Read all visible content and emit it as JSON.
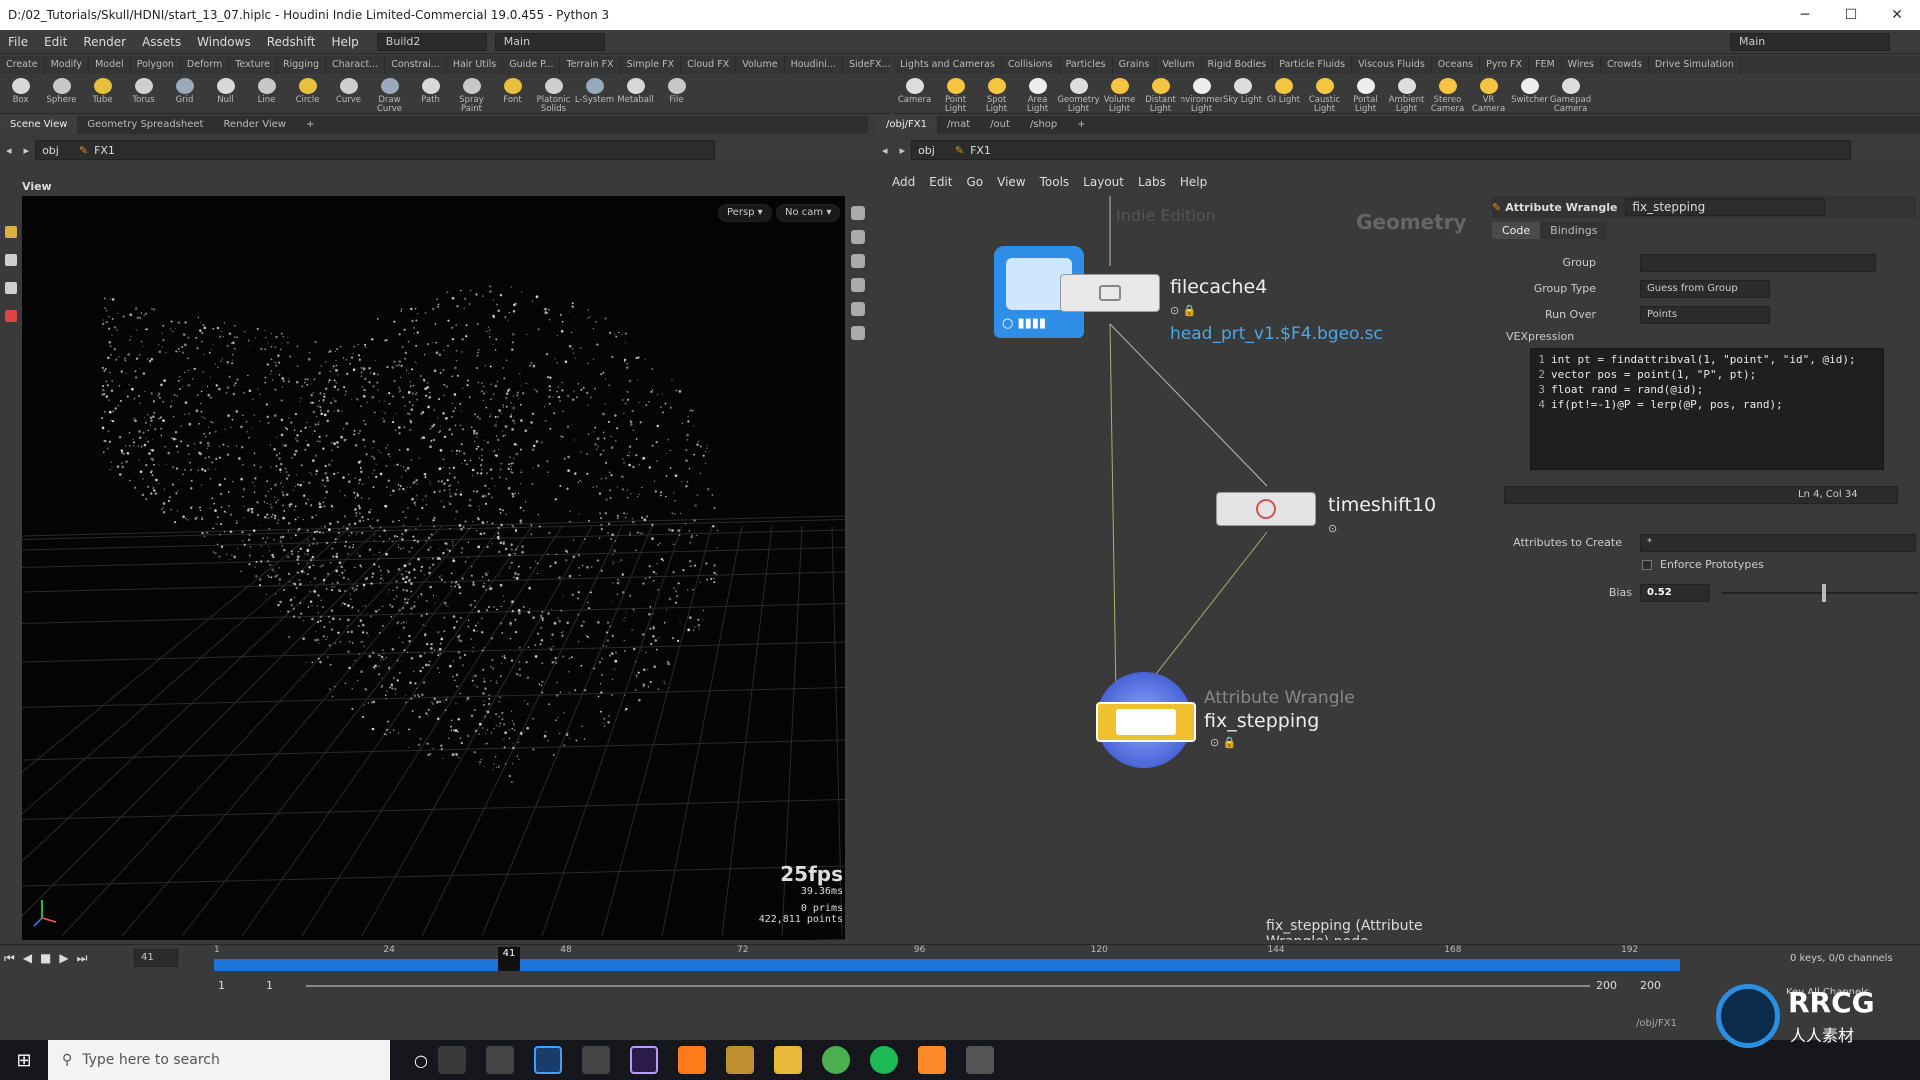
{
  "window": {
    "title": "D:/02_Tutorials/Skull/HDNI/start_13_07.hiplc - Houdini Indie Limited-Commercial 19.0.455 - Python 3",
    "minimize": "─",
    "maximize": "☐",
    "close": "✕"
  },
  "menubar": {
    "items": [
      "File",
      "Edit",
      "Render",
      "Assets",
      "Windows",
      "Redshift",
      "Help"
    ],
    "desktop_left": "Build2",
    "desktop_right": "Main",
    "main_right": "Main"
  },
  "shelf_left": {
    "tabs": [
      "Create",
      "Modify",
      "Model",
      "Polygon",
      "Deform",
      "Texture",
      "Rigging",
      "Charact...",
      "Constrai...",
      "Hair Utils",
      "Guide P...",
      "Terrain FX",
      "Simple FX",
      "Cloud FX",
      "Volume",
      "Houdini...",
      "SideFX..."
    ],
    "tools": [
      "Box",
      "Sphere",
      "Tube",
      "Torus",
      "Grid",
      "Null",
      "Line",
      "Circle",
      "Curve",
      "Draw Curve",
      "Path",
      "Spray Paint",
      "Font",
      "Platonic Solids",
      "L-System",
      "Metaball",
      "File"
    ]
  },
  "shelf_right": {
    "tabs": [
      "Lights and Cameras",
      "Collisions",
      "Particles",
      "Grains",
      "Vellum",
      "Rigid Bodies",
      "Particle Fluids",
      "Viscous Fluids",
      "Oceans",
      "Pyro FX",
      "FEM",
      "Wires",
      "Crowds",
      "Drive Simulation"
    ],
    "tools": [
      "Camera",
      "Point Light",
      "Spot Light",
      "Area Light",
      "Geometry Light",
      "Volume Light",
      "Distant Light",
      "Environment Light",
      "Sky Light",
      "GI Light",
      "Caustic Light",
      "Portal Light",
      "Ambient Light",
      "Stereo Camera",
      "VR Camera",
      "Switcher",
      "Gamepad Camera"
    ]
  },
  "left_pane": {
    "tabs": [
      "Scene View",
      "Geometry Spreadsheet",
      "Render View"
    ],
    "path_obj": "obj",
    "path_node": "FX1",
    "view_label": "View",
    "persp": "Persp ▾",
    "cam": "No cam ▾",
    "fps": "25fps",
    "ms": "39.36ms",
    "prims": "0  prims",
    "points": "422,811 points"
  },
  "right_pane": {
    "tabs": [
      "/obj/FX1",
      "/mat",
      "/out",
      "/shop"
    ],
    "path_obj": "obj",
    "path_node": "FX1",
    "menu": [
      "Add",
      "Edit",
      "Go",
      "View",
      "Tools",
      "Layout",
      "Labs",
      "Help"
    ],
    "watermark_edition": "Indie Edition",
    "context_label": "Geometry",
    "status": "fix_stepping (Attribute Wrangle) node"
  },
  "nodes": {
    "filecache": {
      "name": "filecache4",
      "file": "head_prt_v1.$F4.bgeo.sc"
    },
    "timeshift": {
      "name": "timeshift10"
    },
    "wrangle": {
      "type": "Attribute Wrangle",
      "name": "fix_stepping"
    }
  },
  "params": {
    "node_type": "Attribute Wrangle",
    "node_name": "fix_stepping",
    "tabs": [
      "Code",
      "Bindings"
    ],
    "group_label": "Group",
    "group_value": "",
    "group_type_label": "Group Type",
    "group_type_value": "Guess from Group",
    "run_over_label": "Run Over",
    "run_over_value": "Points",
    "vex_label": "VEXpression",
    "code": [
      "int pt = findattribval(1, \"point\", \"id\", @id);",
      "vector pos = point(1, \"P\", pt);",
      "float rand = rand(@id);",
      "if(pt!=-1)@P = lerp(@P, pos, rand);"
    ],
    "cursor": "Ln 4, Col 34",
    "attrs_label": "Attributes to Create",
    "attrs_value": "*",
    "enforce_label": "Enforce Prototypes",
    "bias_label": "Bias",
    "bias_value": "0.52",
    "bias_fraction": 0.52
  },
  "timeline": {
    "frame": "41",
    "ticks": [
      "1",
      "24",
      "48",
      "72",
      "96",
      "120",
      "144",
      "168",
      "192"
    ],
    "current_marker": "41",
    "range_start": "1",
    "range_start2": "1",
    "range_end": "200",
    "range_end2": "200",
    "keys": "0 keys, 0/0 channels",
    "key_all": "Key All Channels",
    "auto_update": "/obj/FX1"
  },
  "taskbar": {
    "search_placeholder": "Type here to search"
  },
  "watermarks": {
    "site": "RRCG",
    "cn": "人人素材"
  },
  "colors": {
    "accent": "#2a8fe0",
    "playbar": "#1e74d6",
    "node_link": "#4aa8e8"
  }
}
